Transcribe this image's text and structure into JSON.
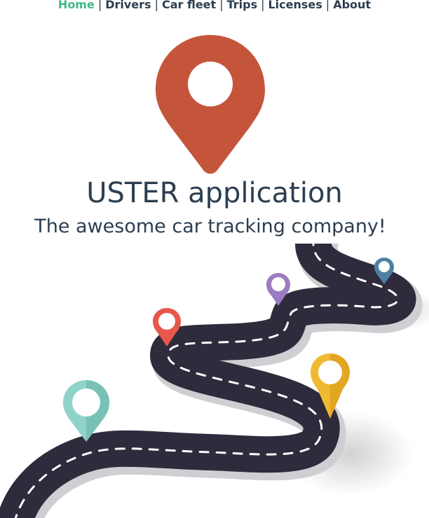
{
  "nav": {
    "items": [
      {
        "label": "Home",
        "active": true
      },
      {
        "label": "Drivers",
        "active": false
      },
      {
        "label": "Car fleet",
        "active": false
      },
      {
        "label": "Trips",
        "active": false
      },
      {
        "label": "Licenses",
        "active": false
      },
      {
        "label": "About",
        "active": false
      }
    ],
    "separator": "|",
    "active_color": "#42b983",
    "text_color": "#2c3e50"
  },
  "logo": {
    "icon": "map-pin-icon",
    "color": "#c4553b"
  },
  "title": "USTER application",
  "subtitle": "The awesome car tracking company!",
  "illustration": {
    "name": "winding-road-illustration",
    "road_color": "#2f2b3d",
    "pins": [
      {
        "icon": "map-pin-icon",
        "color": "#8fd3c8"
      },
      {
        "icon": "map-pin-icon",
        "color": "#e8584a"
      },
      {
        "icon": "map-pin-icon",
        "color": "#9b7cc0"
      },
      {
        "icon": "map-pin-icon",
        "color": "#4d7fa3"
      },
      {
        "icon": "map-pin-icon",
        "color": "#f0b932"
      }
    ]
  }
}
